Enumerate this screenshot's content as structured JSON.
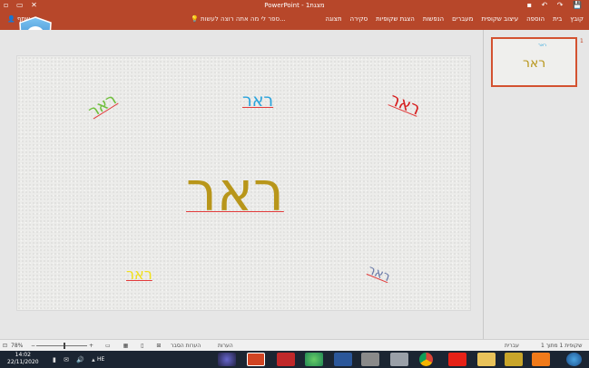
{
  "window": {
    "title": "PowerPoint - מצגת1"
  },
  "ribbon": {
    "tabs": [
      "קובץ",
      "בית",
      "הוספה",
      "עיצוב שקופית",
      "מעברים",
      "הנפשות",
      "הצגת שקופיות",
      "סקירה",
      "תצוגה"
    ],
    "tell_me": "ספר לי מה אתה רוצה לעשות...",
    "share": "שתף"
  },
  "slide": {
    "words": [
      "ראר",
      "ראר",
      "ראר",
      "ראר",
      "ראר",
      "ראר"
    ],
    "colors": [
      "#b8961a",
      "#6fbf3c",
      "#2aa3dc",
      "#d61e1e",
      "#f0e01c",
      "#6a7aa8"
    ]
  },
  "thumbnail": {
    "number": "1",
    "center_word": "ראר",
    "small_word": "ראר"
  },
  "statusbar": {
    "slide_info": "שקופית 1 מתוך 1",
    "language": "עברית",
    "notes": "הערות",
    "comments": "הערות הסבר",
    "zoom": "78%"
  },
  "taskbar": {
    "time": "14:02",
    "date": "22/11/2020",
    "lang": "HE"
  },
  "icons": [
    "shield-logo",
    "app-ppt",
    "app-word",
    "app-chrome",
    "app-folder",
    "app-firefox",
    "app-media",
    "windows-start"
  ]
}
